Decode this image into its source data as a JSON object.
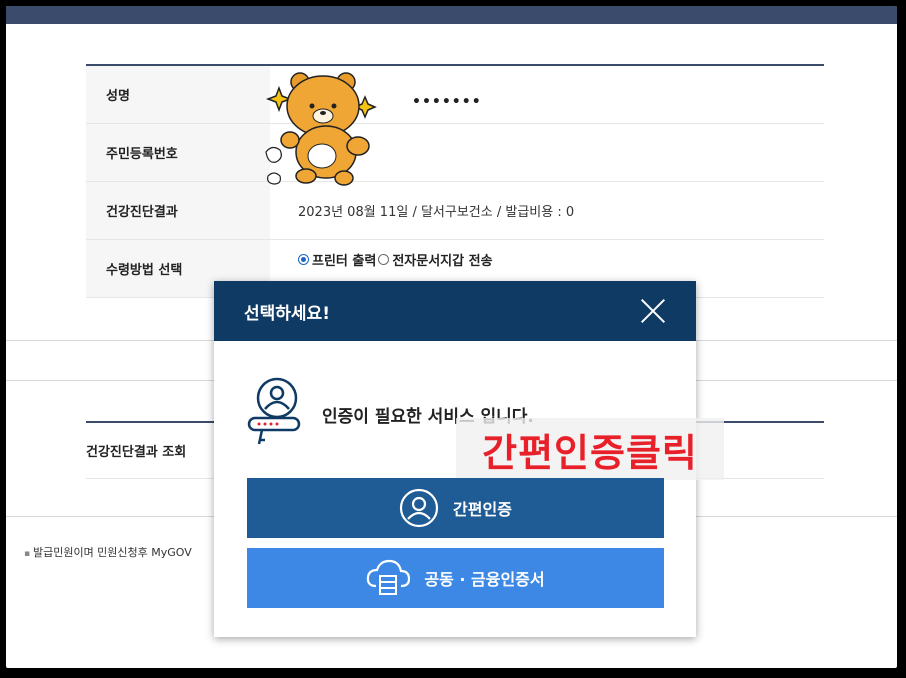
{
  "form": {
    "rows": [
      {
        "label": "성명",
        "value": ""
      },
      {
        "label": "주민등록번호",
        "value": ""
      },
      {
        "label": "건강진단결과",
        "value": "2023년 08월 11일 / 달서구보건소 / 발급비용 : 0"
      },
      {
        "label": "수령방법 선택",
        "value": ""
      }
    ],
    "ssn_dash": "-",
    "ssn_masked": "•••••••",
    "radio_print": "프린터 출력",
    "radio_electronic": "전자문서지갑 전송",
    "selected": "프린터 출력"
  },
  "section2": {
    "label": "건강진단결과 조회"
  },
  "note": "발급민원이며 민원신청후 MyGOV",
  "modal": {
    "title": "선택하세요!",
    "message": "인증이 필요한 서비스 입니다.",
    "overlay": "간편인증클릭",
    "button_simple": "간편인증",
    "button_cert": "공동 · 금융인증서"
  },
  "colors": {
    "header": "#0e3a63",
    "btn_simple": "#1f5b94",
    "btn_cert": "#3c88e4",
    "overlay_text": "#e8202a"
  },
  "icons": [
    "close-icon",
    "certificate-icon",
    "user-auth-icon",
    "cloud-server-icon",
    "bear-sticker"
  ]
}
